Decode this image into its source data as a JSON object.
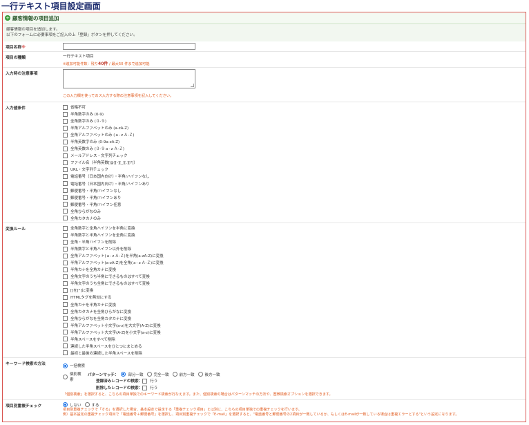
{
  "page": {
    "title": "一行テキスト項目設定画面"
  },
  "panel": {
    "header": "顧客情報の項目追加",
    "intro": [
      "顧客情報の項目を追加します。",
      "以下のフォームに必要事項をご記入の上「登録」ボタンを押してください。"
    ]
  },
  "fields": {
    "name": {
      "label": "項目名称",
      "required_mark": "※"
    },
    "type": {
      "label": "項目の種類",
      "value": "一行テキスト項目",
      "note_prefix": "※追加可能件数：残り",
      "remaining": "40件",
      "note_suffix": " / 最大50 件まで追加可能"
    },
    "notice": {
      "label": "入力時の注意事項",
      "note": "この入力欄を使ってのス入力する際の注意事項を記入してください。"
    },
    "conditions": {
      "label": "入力値条件",
      "options": [
        "省略不可",
        "半角数字のみ (0-9)",
        "全角数字のみ (０-９)",
        "半角アルファベットのみ (a-zA-Z)",
        "全角アルファベットのみ (ａ-ｚＡ-Ｚ)",
        "半角英数字のみ (0-9a-zA-Z)",
        "全角英数のみ (０-９ａ-ｚＡ-Ｚ)",
        "メールアドレス・文字列チェック",
        "ファイル名（半角英数[@][-][_][.][?]）",
        "URL・文字列チェック",
        "電話番号（日本国内向け）・半角/ハイフンなし",
        "電話番号（日本国内向け）・半角/ハイフンあり",
        "郵便番号・半角/ハイフンなし",
        "郵便番号・半角/ハイフンあり",
        "郵便番号・半角/ハイフン任意",
        "全角ひらがなのみ",
        "全角カタカナのみ"
      ]
    },
    "rules": {
      "label": "変換ルール",
      "options": [
        "全角数字と全角ハイフンを半角に変換",
        "半角数字と半角ハイフンを全角に変換",
        "全角・半角ハイフンを削除",
        "半角数字と半角ハイフン以外を削除",
        "全角アルファベット(ａ-ｚＡ-Ｚ)を半角(a-zA-Z)に変換",
        "半角アルファベット(a-zA-Z)を全角(ａ-ｚＡ-Ｚ)に変換",
        "半角カナを全角カナに変換",
        "全角文字のうち半角にできるものはすべて変換",
        "半角文字のうち全角にできるものはすべて変換",
        "[]を[\"]に変換",
        "HTMLタグを無効にする",
        "全角カナを半角カナに変換",
        "全角カタカナを全角ひらがなに変換",
        "全角ひらがなを全角カタカナに変換",
        "半角アルファベット小文字(a-z)を大文字(A-Z)に変換",
        "半角アルファベット大文字(A-Z)を小文字(a-z)に変換",
        "半角スペースをすべて削除",
        "連続した半角スペースをひとつにまとめる",
        "最初と最後の連続した半角スペースを削除"
      ]
    },
    "search": {
      "label": "キーワード検索の方法",
      "opt_all": "一括検索",
      "opt_each": "個別検索",
      "pattern_label": "パターンマッチ：",
      "patterns": [
        "部分一致",
        "完全一致",
        "前方一致",
        "後方一致"
      ],
      "registered_label": "登録済みレコードの検索：",
      "registered_do": "行う",
      "deleted_label": "削除したレコードの検索：",
      "deleted_do": "行う",
      "note": "「個別検索」を選択すると、こちらの項目単独でのキーワード検索が行なえます。また、個別検索の場合はパターンマッチの方法や、歴徴検索オプションを選択できます。"
    },
    "dup": {
      "label": "項目別重複チェック",
      "opt_no": "しない",
      "opt_yes": "する",
      "note1": "項目別重複チェックで「する」を選択した場合、基本設定で設定する「重複チェック項目」とは別に、こちらの項目単独での重複チェックを行います。",
      "note2": "例）基本設定の重複チェック項目で「電話番号＋郵便番号」を選択し、項目別重複チェックで「E-mail」を選択すると、\"電話番号と郵便番号の2項目が一致しているか、もしくはE-mailが一致している場合は重複エラーとする\"という設定になります。"
    }
  }
}
